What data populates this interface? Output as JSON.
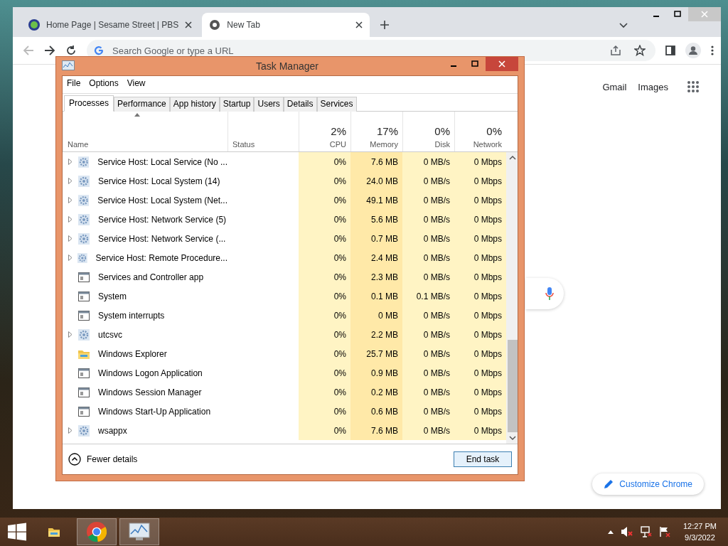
{
  "browser": {
    "tabs": [
      {
        "title": "Home Page | Sesame Street | PBS",
        "selected": false
      },
      {
        "title": "New Tab",
        "selected": true
      }
    ],
    "omnibox": {
      "placeholder": "Search Google or type a URL"
    },
    "links": [
      "Gmail",
      "Images"
    ],
    "customize": "Customize Chrome"
  },
  "task_manager": {
    "title": "Task Manager",
    "menu": [
      "File",
      "Options",
      "View"
    ],
    "tabs": [
      {
        "label": "Processes",
        "selected": true
      },
      {
        "label": "Performance",
        "selected": false
      },
      {
        "label": "App history",
        "selected": false
      },
      {
        "label": "Startup",
        "selected": false
      },
      {
        "label": "Users",
        "selected": false
      },
      {
        "label": "Details",
        "selected": false
      },
      {
        "label": "Services",
        "selected": false
      }
    ],
    "columns": [
      {
        "label": "Name"
      },
      {
        "label": "Status"
      },
      {
        "label": "CPU",
        "total": "2%"
      },
      {
        "label": "Memory",
        "total": "17%"
      },
      {
        "label": "Disk",
        "total": "0%"
      },
      {
        "label": "Network",
        "total": "0%"
      }
    ],
    "rows": [
      {
        "name": "Service Host: Local Service (No ...",
        "kind": "service",
        "expandable": true,
        "cpu": "0%",
        "memory": "7.6 MB",
        "disk": "0 MB/s",
        "network": "0 Mbps"
      },
      {
        "name": "Service Host: Local System (14)",
        "kind": "service",
        "expandable": true,
        "cpu": "0%",
        "memory": "24.0 MB",
        "disk": "0 MB/s",
        "network": "0 Mbps"
      },
      {
        "name": "Service Host: Local System (Net...",
        "kind": "service",
        "expandable": true,
        "cpu": "0%",
        "memory": "49.1 MB",
        "disk": "0 MB/s",
        "network": "0 Mbps"
      },
      {
        "name": "Service Host: Network Service (5)",
        "kind": "service",
        "expandable": true,
        "cpu": "0%",
        "memory": "5.6 MB",
        "disk": "0 MB/s",
        "network": "0 Mbps"
      },
      {
        "name": "Service Host: Network Service (...",
        "kind": "service",
        "expandable": true,
        "cpu": "0%",
        "memory": "0.7 MB",
        "disk": "0 MB/s",
        "network": "0 Mbps"
      },
      {
        "name": "Service Host: Remote Procedure...",
        "kind": "service",
        "expandable": true,
        "cpu": "0%",
        "memory": "2.4 MB",
        "disk": "0 MB/s",
        "network": "0 Mbps"
      },
      {
        "name": "Services and Controller app",
        "kind": "app",
        "expandable": false,
        "cpu": "0%",
        "memory": "2.3 MB",
        "disk": "0 MB/s",
        "network": "0 Mbps"
      },
      {
        "name": "System",
        "kind": "app",
        "expandable": false,
        "cpu": "0%",
        "memory": "0.1 MB",
        "disk": "0.1 MB/s",
        "network": "0 Mbps"
      },
      {
        "name": "System interrupts",
        "kind": "app",
        "expandable": false,
        "cpu": "0%",
        "memory": "0 MB",
        "disk": "0 MB/s",
        "network": "0 Mbps"
      },
      {
        "name": "utcsvc",
        "kind": "service",
        "expandable": true,
        "cpu": "0%",
        "memory": "2.2 MB",
        "disk": "0 MB/s",
        "network": "0 Mbps"
      },
      {
        "name": "Windows Explorer",
        "kind": "folder",
        "expandable": false,
        "cpu": "0%",
        "memory": "25.7 MB",
        "disk": "0 MB/s",
        "network": "0 Mbps"
      },
      {
        "name": "Windows Logon Application",
        "kind": "app",
        "expandable": false,
        "cpu": "0%",
        "memory": "0.9 MB",
        "disk": "0 MB/s",
        "network": "0 Mbps"
      },
      {
        "name": "Windows Session Manager",
        "kind": "app",
        "expandable": false,
        "cpu": "0%",
        "memory": "0.2 MB",
        "disk": "0 MB/s",
        "network": "0 Mbps"
      },
      {
        "name": "Windows Start-Up Application",
        "kind": "app",
        "expandable": false,
        "cpu": "0%",
        "memory": "0.6 MB",
        "disk": "0 MB/s",
        "network": "0 Mbps"
      },
      {
        "name": "wsappx",
        "kind": "service",
        "expandable": true,
        "cpu": "0%",
        "memory": "7.6 MB",
        "disk": "0 MB/s",
        "network": "0 Mbps"
      }
    ],
    "fewer_details": "Fewer details",
    "end_task": "End task"
  },
  "taskbar": {
    "apps": [
      {
        "kind": "explorer",
        "selected": false
      },
      {
        "kind": "chrome",
        "selected": true
      },
      {
        "kind": "taskmgr",
        "selected": true
      }
    ],
    "time": "12:27 PM",
    "date": "9/3/2022"
  }
}
